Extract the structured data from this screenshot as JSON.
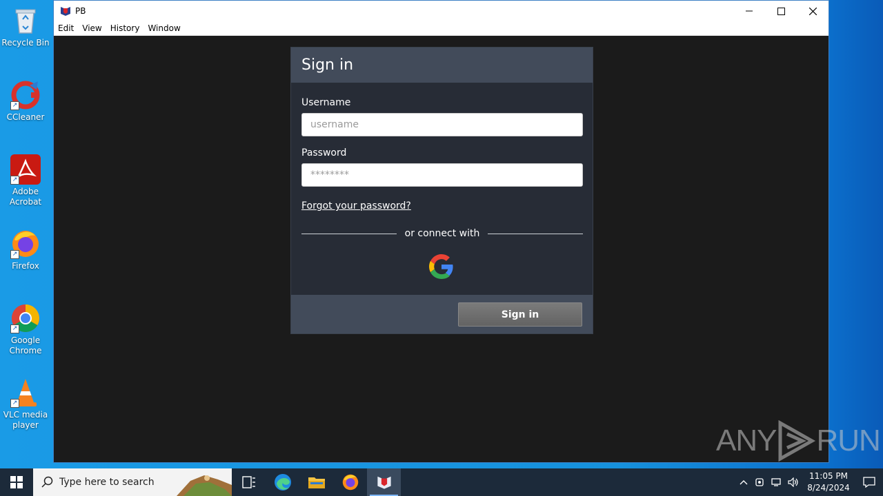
{
  "desktop": {
    "icons": [
      {
        "label": "Recycle Bin"
      },
      {
        "label": "CCleaner"
      },
      {
        "label": "Adobe Acrobat"
      },
      {
        "label": "Firefox"
      },
      {
        "label": "Google Chrome"
      },
      {
        "label": "VLC media player"
      }
    ]
  },
  "window": {
    "title": "PB",
    "menu": [
      "Edit",
      "View",
      "History",
      "Window"
    ]
  },
  "signin": {
    "heading": "Sign in",
    "username_label": "Username",
    "username_placeholder": "username",
    "password_label": "Password",
    "password_placeholder": "********",
    "forgot_link": "Forgot your password?",
    "connect_text": "or connect with",
    "submit_label": "Sign in"
  },
  "watermark": {
    "left": "ANY",
    "right": "RUN"
  },
  "taskbar": {
    "search_placeholder": "Type here to search",
    "time": "11:05 PM",
    "date": "8/24/2024"
  },
  "colors": {
    "panel_bg": "#272c36",
    "panel_header": "#424b5a",
    "window_bg": "#1b1b1b",
    "button_bg": "#6e6e6e"
  }
}
